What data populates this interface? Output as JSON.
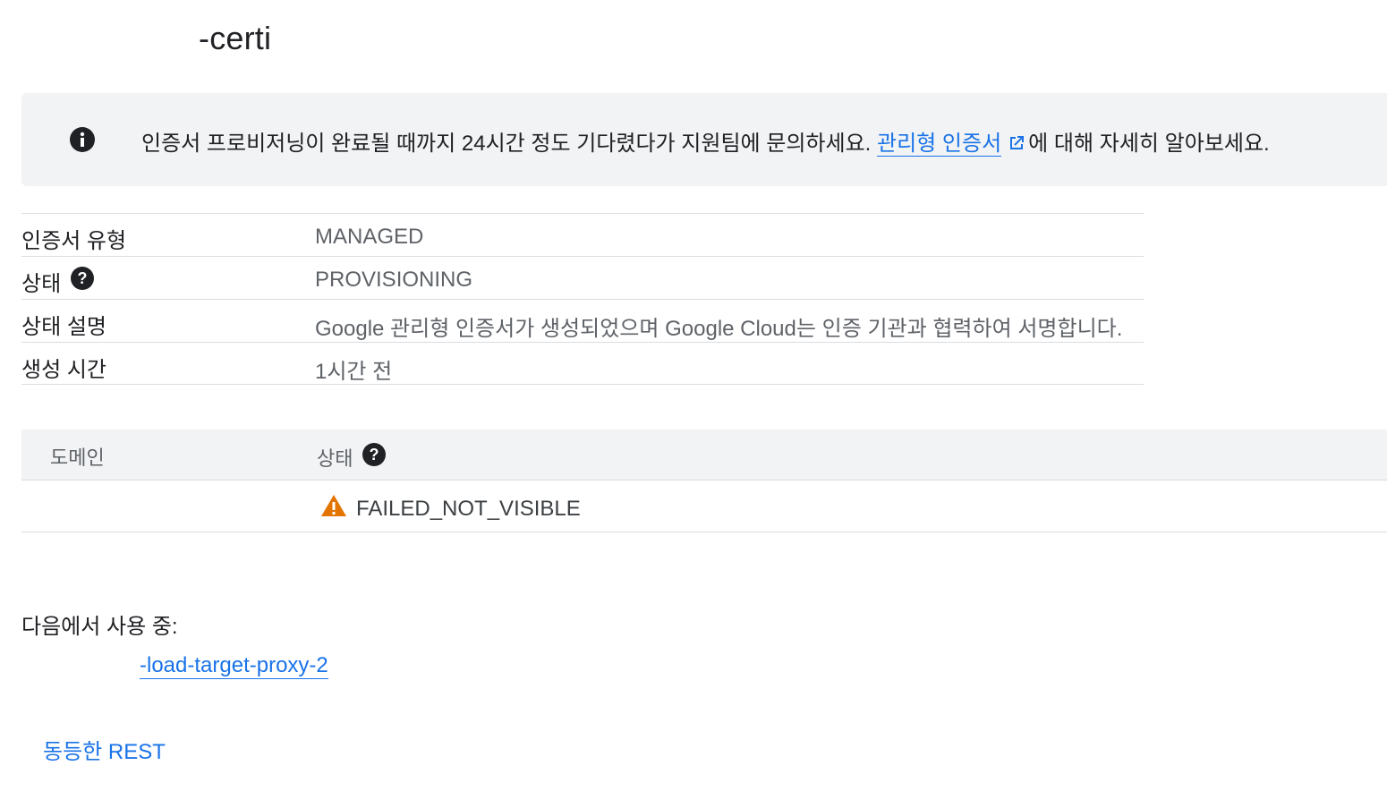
{
  "header": {
    "title": "-certi"
  },
  "banner": {
    "text": "인증서 프로비저닝이 완료될 때까지 24시간 정도 기다렸다가 지원팀에 문의하세요. ",
    "link_text": "관리형 인증서",
    "suffix": "에 대해 자세히 알아보세요.",
    "icon": "info-icon"
  },
  "properties": [
    {
      "label": "인증서 유형",
      "value": "MANAGED"
    },
    {
      "label": "상태",
      "value": "PROVISIONING"
    },
    {
      "label": "상태 설명",
      "value": "Google 관리형 인증서가 생성되었으며 Google Cloud는 인증 기관과 협력하여 서명합니다."
    },
    {
      "label": "생성 시간",
      "value": "1시간 전"
    }
  ],
  "domains": {
    "columns": [
      "도메인",
      "상태"
    ],
    "rows": [
      {
        "domain": "",
        "status": "FAILED_NOT_VISIBLE",
        "status_icon": "warning-icon",
        "status_color": "#e37400"
      }
    ]
  },
  "usage": {
    "label": "다음에서 사용 중:",
    "link": "-load-target-proxy-2"
  },
  "footer": {
    "rest_link": "동등한 REST"
  },
  "colors": {
    "link": "#1a73e8",
    "banner_bg": "#f1f3f4",
    "warning": "#e37400"
  }
}
